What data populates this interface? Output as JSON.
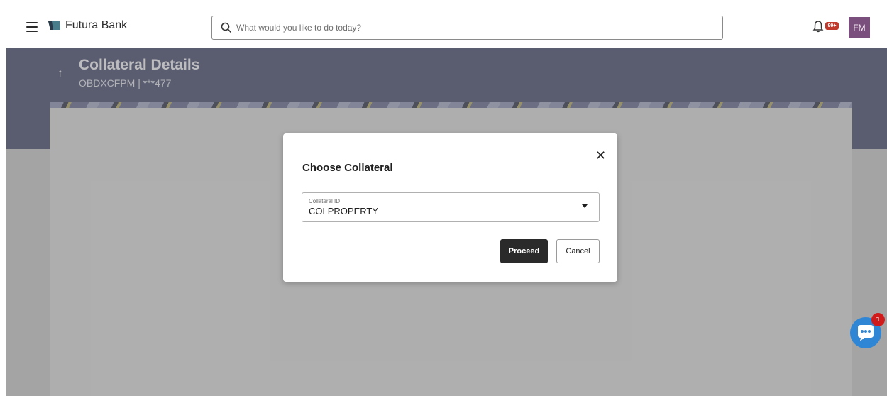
{
  "header": {
    "brand": "Futura Bank",
    "search_placeholder": "What would you like to do today?",
    "notification_badge": "99+",
    "avatar_initials": "FM"
  },
  "page": {
    "title": "Collateral Details",
    "subtitle": "OBDXCFPM | ***477"
  },
  "modal": {
    "title": "Choose Collateral",
    "field_label": "Collateral ID",
    "field_value": "COLPROPERTY",
    "proceed_label": "Proceed",
    "cancel_label": "Cancel"
  },
  "chat": {
    "badge_count": "1"
  },
  "colors": {
    "banner": "#454b6c",
    "primary_button": "#2a2a2a",
    "avatar_bg": "#7a4f7d",
    "chat_bubble": "#2f86d4",
    "badge_red": "#d11a1a"
  }
}
